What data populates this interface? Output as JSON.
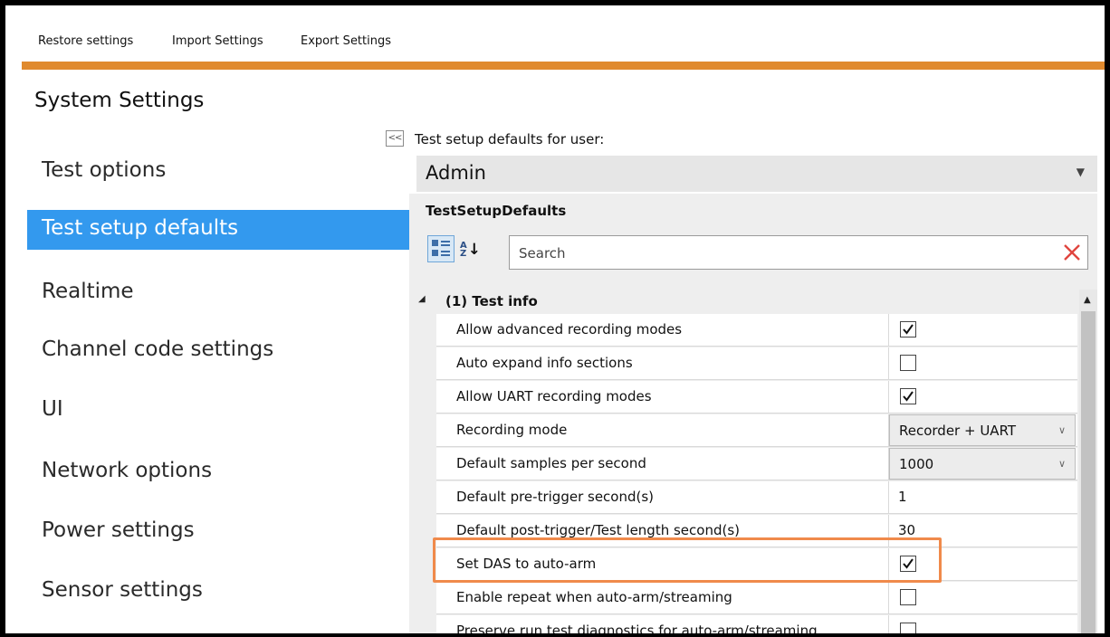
{
  "menu": {
    "items": [
      {
        "label": "Restore settings"
      },
      {
        "label": "Import Settings"
      },
      {
        "label": "Export Settings"
      }
    ]
  },
  "colors": {
    "accent": "#e08a2e",
    "selection": "#3399ee",
    "highlight": "#f08a4b"
  },
  "app_title": "System Settings",
  "nav": {
    "items": [
      {
        "label": "Test options"
      },
      {
        "label": "Test setup defaults",
        "active": true
      },
      {
        "label": "Realtime"
      },
      {
        "label": "Channel code settings"
      },
      {
        "label": "UI"
      },
      {
        "label": "Network options"
      },
      {
        "label": "Power settings"
      },
      {
        "label": "Sensor settings"
      }
    ]
  },
  "collapse_button": "<<",
  "user_defaults": {
    "label": "Test setup defaults for user:",
    "selected": "Admin"
  },
  "property_grid": {
    "title": "TestSetupDefaults",
    "search_placeholder": "Search",
    "category": {
      "label": "(1) Test info",
      "expanded": true
    },
    "rows": [
      {
        "name": "Allow advanced recording modes",
        "type": "checkbox",
        "checked": true
      },
      {
        "name": "Auto expand info sections",
        "type": "checkbox",
        "checked": false
      },
      {
        "name": "Allow UART recording modes",
        "type": "checkbox",
        "checked": true
      },
      {
        "name": "Recording mode",
        "type": "select",
        "value": "Recorder + UART"
      },
      {
        "name": "Default samples per second",
        "type": "select",
        "value": "1000"
      },
      {
        "name": "Default pre-trigger second(s)",
        "type": "text",
        "value": "1"
      },
      {
        "name": "Default post-trigger/Test length second(s)",
        "type": "text",
        "value": "30"
      },
      {
        "name": "Set DAS to auto-arm",
        "type": "checkbox",
        "checked": true
      },
      {
        "name": "Enable repeat when auto-arm/streaming",
        "type": "checkbox",
        "checked": false
      },
      {
        "name": "Preserve run test diagnostics for auto-arm/streaming",
        "type": "checkbox",
        "checked": false
      }
    ]
  }
}
